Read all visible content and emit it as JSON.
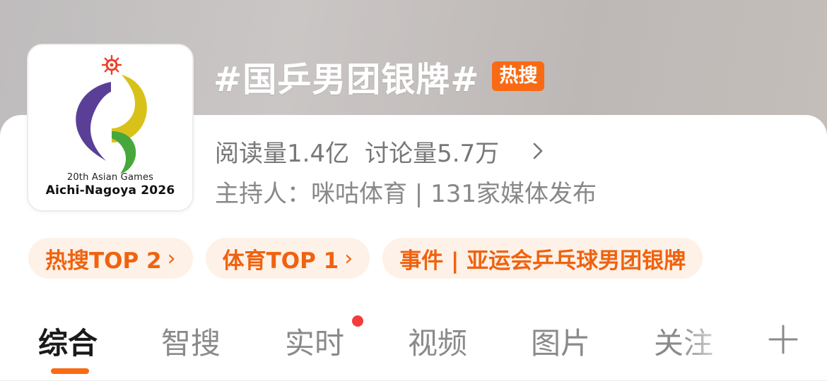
{
  "topic": {
    "title": "#国乒男团银牌#",
    "badge": "热搜"
  },
  "logo": {
    "line1": "20th Asian Games",
    "line2": "Aichi-Nagoya 2026",
    "colors": {
      "purple": "#5b3f96",
      "yellow": "#d8c21a",
      "green": "#46a83c",
      "red": "#e8402a"
    }
  },
  "stats": {
    "reads": "阅读量1.4亿",
    "discussions": "讨论量5.7万",
    "chevron_icon": "chevron-right-icon"
  },
  "host": {
    "text": "主持人：咪咕体育 | 131家媒体发布"
  },
  "chips": [
    {
      "label": "热搜TOP 2",
      "chevron": "›"
    },
    {
      "label": "体育TOP 1",
      "chevron": "›"
    },
    {
      "label": "事件 | 亚运会乒乓球男团银牌"
    }
  ],
  "tabs": [
    {
      "label": "综合",
      "active": true
    },
    {
      "label": "智搜"
    },
    {
      "label": "实时",
      "has_dot": true
    },
    {
      "label": "视频"
    },
    {
      "label": "图片"
    },
    {
      "label": "关注"
    }
  ],
  "add_tab_icon": "plus-icon",
  "colors": {
    "accent": "#fa6a14",
    "chip_bg": "#fdf1e8",
    "chip_text": "#f0620e",
    "dot": "#f53c3c"
  }
}
